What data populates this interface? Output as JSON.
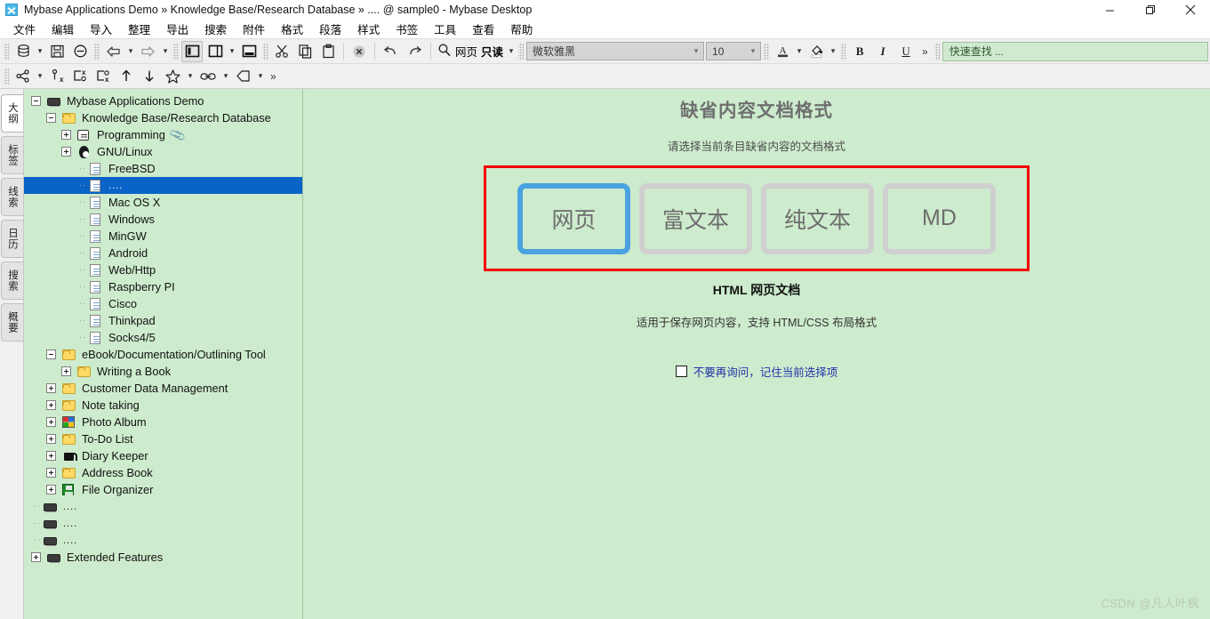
{
  "window": {
    "title": "Mybase Applications Demo » Knowledge Base/Research Database » .... @ sample0 - Mybase Desktop",
    "minimize": "—",
    "maximize": "❐",
    "close": "✕"
  },
  "menubar": {
    "items": [
      {
        "label": "文件"
      },
      {
        "label": "编辑"
      },
      {
        "label": "导入"
      },
      {
        "label": "整理"
      },
      {
        "label": "导出"
      },
      {
        "label": "搜索"
      },
      {
        "label": "附件"
      },
      {
        "label": "格式"
      },
      {
        "label": "段落"
      },
      {
        "label": "样式"
      },
      {
        "label": "书签"
      },
      {
        "label": "工具"
      },
      {
        "label": "查看"
      },
      {
        "label": "帮助"
      }
    ]
  },
  "toolbar": {
    "row1": {
      "database": "database-icon",
      "save": "save-icon",
      "remove": "minus-circle-icon",
      "back": "back-arrow-icon",
      "forward": "forward-arrow-icon",
      "layout_left": "layout-left-icon",
      "layout_panel": "layout-panel-icon",
      "layout_bottom": "layout-bottom-icon",
      "cut": "scissors-icon",
      "copy": "copy-icon",
      "paste": "paste-icon",
      "delete": "delete-x-icon",
      "undo": "undo-icon",
      "redo": "redo-icon",
      "find_icon": "magnifier-icon",
      "find_mode": "网页",
      "find_state": "只读",
      "font_name": "微软雅黑",
      "font_size": "10",
      "font_color": "font-color-icon",
      "highlight": "highlight-icon",
      "bold": "B",
      "italic": "I",
      "underline": "U",
      "overflow": "»",
      "quick_find_placeholder": "快速查找 ..."
    },
    "row2": {
      "share": "share-nodes-icon",
      "unlink_node": "node-remove-icon",
      "clear_marks": "clear-marks-icon",
      "clear_tags": "clear-tags-icon",
      "move_up": "arrow-up-icon",
      "move_down": "arrow-down-icon",
      "favorite": "star-icon",
      "link": "link-icon",
      "tag": "tag-icon",
      "overflow": "»"
    }
  },
  "vtabs": {
    "items": [
      {
        "label": "大纲",
        "selected": true
      },
      {
        "label": "标签",
        "selected": false
      },
      {
        "label": "线索",
        "selected": false
      },
      {
        "label": "日历",
        "selected": false
      },
      {
        "label": "搜索",
        "selected": false
      },
      {
        "label": "概要",
        "selected": false
      }
    ]
  },
  "tree": {
    "nodes": [
      {
        "label": "Mybase Applications Demo",
        "indent": 0,
        "toggle": "minus",
        "icon": "database-icon",
        "selected": false
      },
      {
        "label": "Knowledge Base/Research Database",
        "indent": 1,
        "toggle": "minus",
        "icon": "folder-icon",
        "selected": false
      },
      {
        "label": "Programming",
        "indent": 2,
        "toggle": "plus",
        "icon": "note-icon",
        "selected": false,
        "attachment": "📎"
      },
      {
        "label": "GNU/Linux",
        "indent": 2,
        "toggle": "plus",
        "icon": "penguin-icon",
        "selected": false
      },
      {
        "label": "FreeBSD",
        "indent": 3,
        "toggle": "none",
        "icon": "doc-icon",
        "selected": false
      },
      {
        "label": "....",
        "indent": 3,
        "toggle": "none",
        "icon": "doc-icon",
        "selected": true
      },
      {
        "label": "Mac OS X",
        "indent": 3,
        "toggle": "none",
        "icon": "doc-icon",
        "selected": false
      },
      {
        "label": "Windows",
        "indent": 3,
        "toggle": "none",
        "icon": "doc-icon",
        "selected": false
      },
      {
        "label": "MinGW",
        "indent": 3,
        "toggle": "none",
        "icon": "doc-icon",
        "selected": false
      },
      {
        "label": "Android",
        "indent": 3,
        "toggle": "none",
        "icon": "doc-icon",
        "selected": false
      },
      {
        "label": "Web/Http",
        "indent": 3,
        "toggle": "none",
        "icon": "doc-icon",
        "selected": false
      },
      {
        "label": "Raspberry PI",
        "indent": 3,
        "toggle": "none",
        "icon": "doc-icon",
        "selected": false
      },
      {
        "label": "Cisco",
        "indent": 3,
        "toggle": "none",
        "icon": "doc-icon",
        "selected": false
      },
      {
        "label": "Thinkpad",
        "indent": 3,
        "toggle": "none",
        "icon": "doc-icon",
        "selected": false
      },
      {
        "label": "Socks4/5",
        "indent": 3,
        "toggle": "none",
        "icon": "doc-icon",
        "selected": false
      },
      {
        "label": "eBook/Documentation/Outlining Tool",
        "indent": 1,
        "toggle": "minus",
        "icon": "folder-icon",
        "selected": false
      },
      {
        "label": "Writing a Book",
        "indent": 2,
        "toggle": "plus",
        "icon": "folder-icon",
        "selected": false
      },
      {
        "label": "Customer Data Management",
        "indent": 1,
        "toggle": "plus",
        "icon": "folder-icon",
        "selected": false
      },
      {
        "label": "Note taking",
        "indent": 1,
        "toggle": "plus",
        "icon": "folder-icon",
        "selected": false
      },
      {
        "label": "Photo Album",
        "indent": 1,
        "toggle": "plus",
        "icon": "photo-icon",
        "selected": false
      },
      {
        "label": "To-Do List",
        "indent": 1,
        "toggle": "plus",
        "icon": "folder-icon",
        "selected": false
      },
      {
        "label": "Diary Keeper",
        "indent": 1,
        "toggle": "plus",
        "icon": "lock-icon",
        "selected": false
      },
      {
        "label": "Address Book",
        "indent": 1,
        "toggle": "plus",
        "icon": "folder-icon",
        "selected": false
      },
      {
        "label": "File Organizer",
        "indent": 1,
        "toggle": "plus",
        "icon": "floppy-icon",
        "selected": false
      },
      {
        "label": "....",
        "indent": 0,
        "toggle": "none",
        "icon": "database-icon",
        "selected": false
      },
      {
        "label": "....",
        "indent": 0,
        "toggle": "none",
        "icon": "database-icon",
        "selected": false
      },
      {
        "label": "....",
        "indent": 0,
        "toggle": "none",
        "icon": "database-icon",
        "selected": false
      },
      {
        "label": "Extended Features",
        "indent": 0,
        "toggle": "plus",
        "icon": "database-icon",
        "selected": false
      }
    ]
  },
  "dialog": {
    "title": "缺省内容文档格式",
    "subtitle": "请选择当前条目缺省内容的文档格式",
    "options": [
      {
        "label": "网页",
        "selected": true
      },
      {
        "label": "富文本",
        "selected": false
      },
      {
        "label": "纯文本",
        "selected": false
      },
      {
        "label": "MD",
        "selected": false
      }
    ],
    "selected_format_name": "HTML 网页文档",
    "selected_format_desc": "适用于保存网页内容，支持 HTML/CSS 布局格式",
    "remember_label": "不要再询问，记住当前选择项",
    "remember_checked": false,
    "highlight_border_color": "#f60000",
    "selected_card_border_color": "#4aa3e0"
  },
  "watermark": "CSDN @凡人叶枫"
}
